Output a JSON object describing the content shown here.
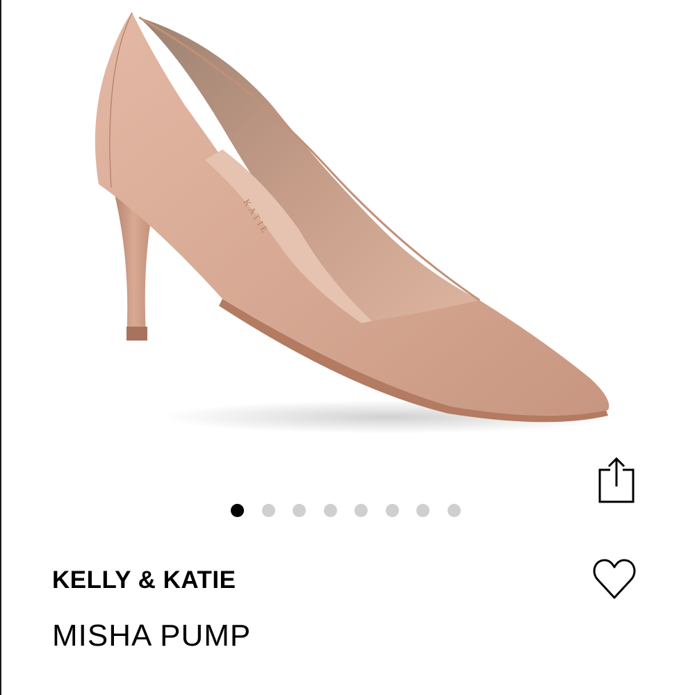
{
  "product": {
    "brand": "KELLY & KATIE",
    "name": "MISHA PUMP",
    "insole_print": "KATIE",
    "image_icon": "nude-pump-photo",
    "color": "#d6a892"
  },
  "actions": {
    "share_icon": "share-icon",
    "favorite_icon": "heart-icon"
  },
  "carousel": {
    "total_images": 8,
    "active_index": 0
  }
}
